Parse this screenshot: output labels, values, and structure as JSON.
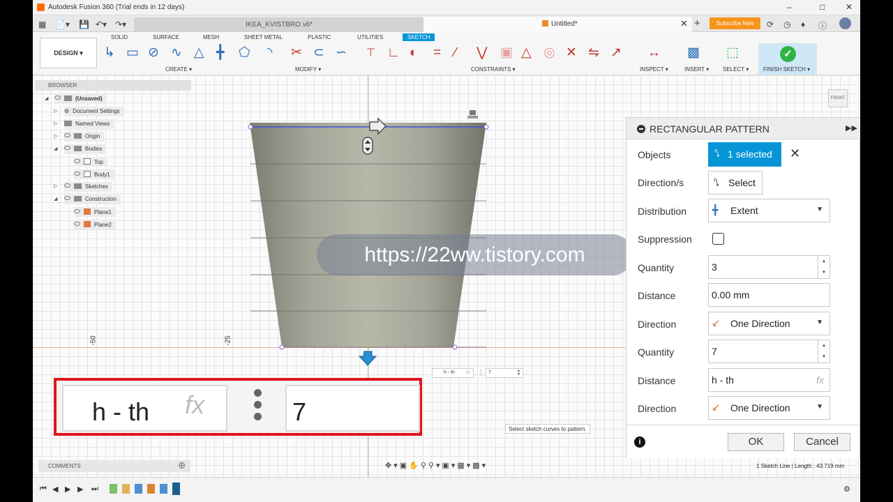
{
  "titlebar": {
    "title": "Autodesk Fusion 360 (Trial ends in 12 days)"
  },
  "tabs": {
    "inactive": "IKEA_KVISTBRO v6*",
    "active": "Untitled*",
    "subscribe": "Subscribe Now"
  },
  "toolbar": {
    "design": "DESIGN ▾",
    "workspaces": [
      "SOLID",
      "SURFACE",
      "MESH",
      "SHEET METAL",
      "PLASTIC",
      "UTILITIES",
      "SKETCH"
    ],
    "groups": {
      "create": "CREATE ▾",
      "modify": "MODIFY ▾",
      "constraints": "CONSTRAINTS ▾",
      "inspect": "INSPECT ▾",
      "insert": "INSERT ▾",
      "select": "SELECT ▾",
      "finish": "FINISH SKETCH ▾"
    }
  },
  "browser": {
    "title": "BROWSER",
    "items": [
      "(Unsaved)",
      "Document Settings",
      "Named Views",
      "Origin",
      "Bodies",
      "Top",
      "Body1",
      "Sketches",
      "Construction",
      "Plane1",
      "Plane2"
    ]
  },
  "ruler": {
    "minus50": "-50",
    "minus25": "-25"
  },
  "watermark": "https://22ww.tistory.com",
  "small_input": {
    "expr": "h - th",
    "fx": "fx",
    "value": "7"
  },
  "callout": {
    "expr": "h - th",
    "fx": "fx",
    "value": "7"
  },
  "tooltip": "Select sketch curves to pattern.",
  "viewcube": {
    "face": "FRONT"
  },
  "panel": {
    "title": "RECTANGULAR PATTERN",
    "labels": {
      "objects": "Objects",
      "directions": "Direction/s",
      "distribution": "Distribution",
      "suppression": "Suppression",
      "quantity1": "Quantity",
      "distance1": "Distance",
      "direction1": "Direction",
      "quantity2": "Quantity",
      "distance2": "Distance",
      "direction2": "Direction"
    },
    "values": {
      "objects": "1 selected",
      "directions": "Select",
      "distribution": "Extent",
      "quantity1": "3",
      "distance1": "0.00 mm",
      "direction1": "One Direction",
      "quantity2": "7",
      "distance2": "h - th",
      "distance2_fx": "fx",
      "direction2": "One Direction"
    },
    "ok": "OK",
    "cancel": "Cancel"
  },
  "comments": "COMMENTS",
  "status": "1 Sketch Line | Length : 43.719 mm",
  "colors": {
    "accent": "#0696d7",
    "finish": "#2fb345",
    "callout": "#e1151c",
    "subscribe": "#f7941d"
  }
}
